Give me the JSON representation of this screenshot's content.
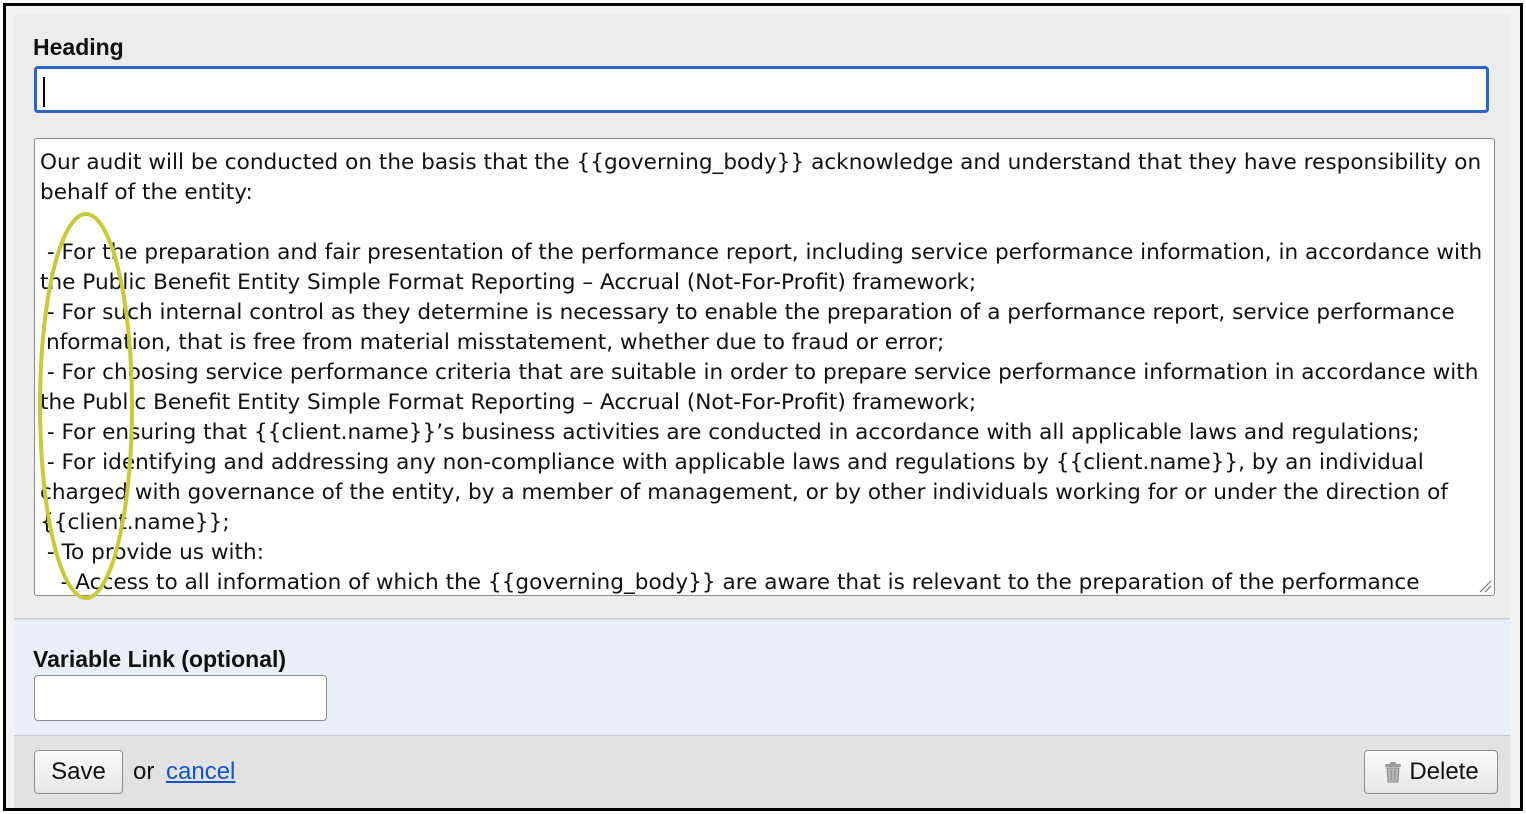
{
  "form": {
    "heading_label": "Heading",
    "heading_value": "",
    "content_text": "Our audit will be conducted on the basis that the {{governing_body}} acknowledge and understand that they have responsibility on behalf of the entity:\n\n - For the preparation and fair presentation of the performance report, including service performance information, in accordance with the Public Benefit Entity Simple Format Reporting – Accrual (Not-For-Profit) framework;\n - For such internal control as they determine is necessary to enable the preparation of a performance report, service performance information, that is free from material misstatement, whether due to fraud or error;\n - For choosing service performance criteria that are suitable in order to prepare service performance information in accordance with the Public Benefit Entity Simple Format Reporting – Accrual (Not-For-Profit) framework;\n - For ensuring that {{client.name}}’s business activities are conducted in accordance with all applicable laws and regulations;\n - For identifying and addressing any non-compliance with applicable laws and regulations by {{client.name}}, by an individual charged with governance of the entity, by a member of management, or by other individuals working for or under the direction of {{client.name}};\n - To provide us with:\n   - Access to all information of which the {{governing_body}} are aware that is relevant to the preparation of the performance",
    "variable_link_label": "Variable Link (optional)",
    "variable_link_value": ""
  },
  "footer": {
    "save_label": "Save",
    "or_text": "or",
    "cancel_label": "cancel",
    "delete_label": "Delete"
  },
  "colors": {
    "focus_border": "#2b66c4",
    "link": "#1155cc",
    "annotation": "#c9c93a",
    "variable_section_bg": "#e8eff8"
  }
}
